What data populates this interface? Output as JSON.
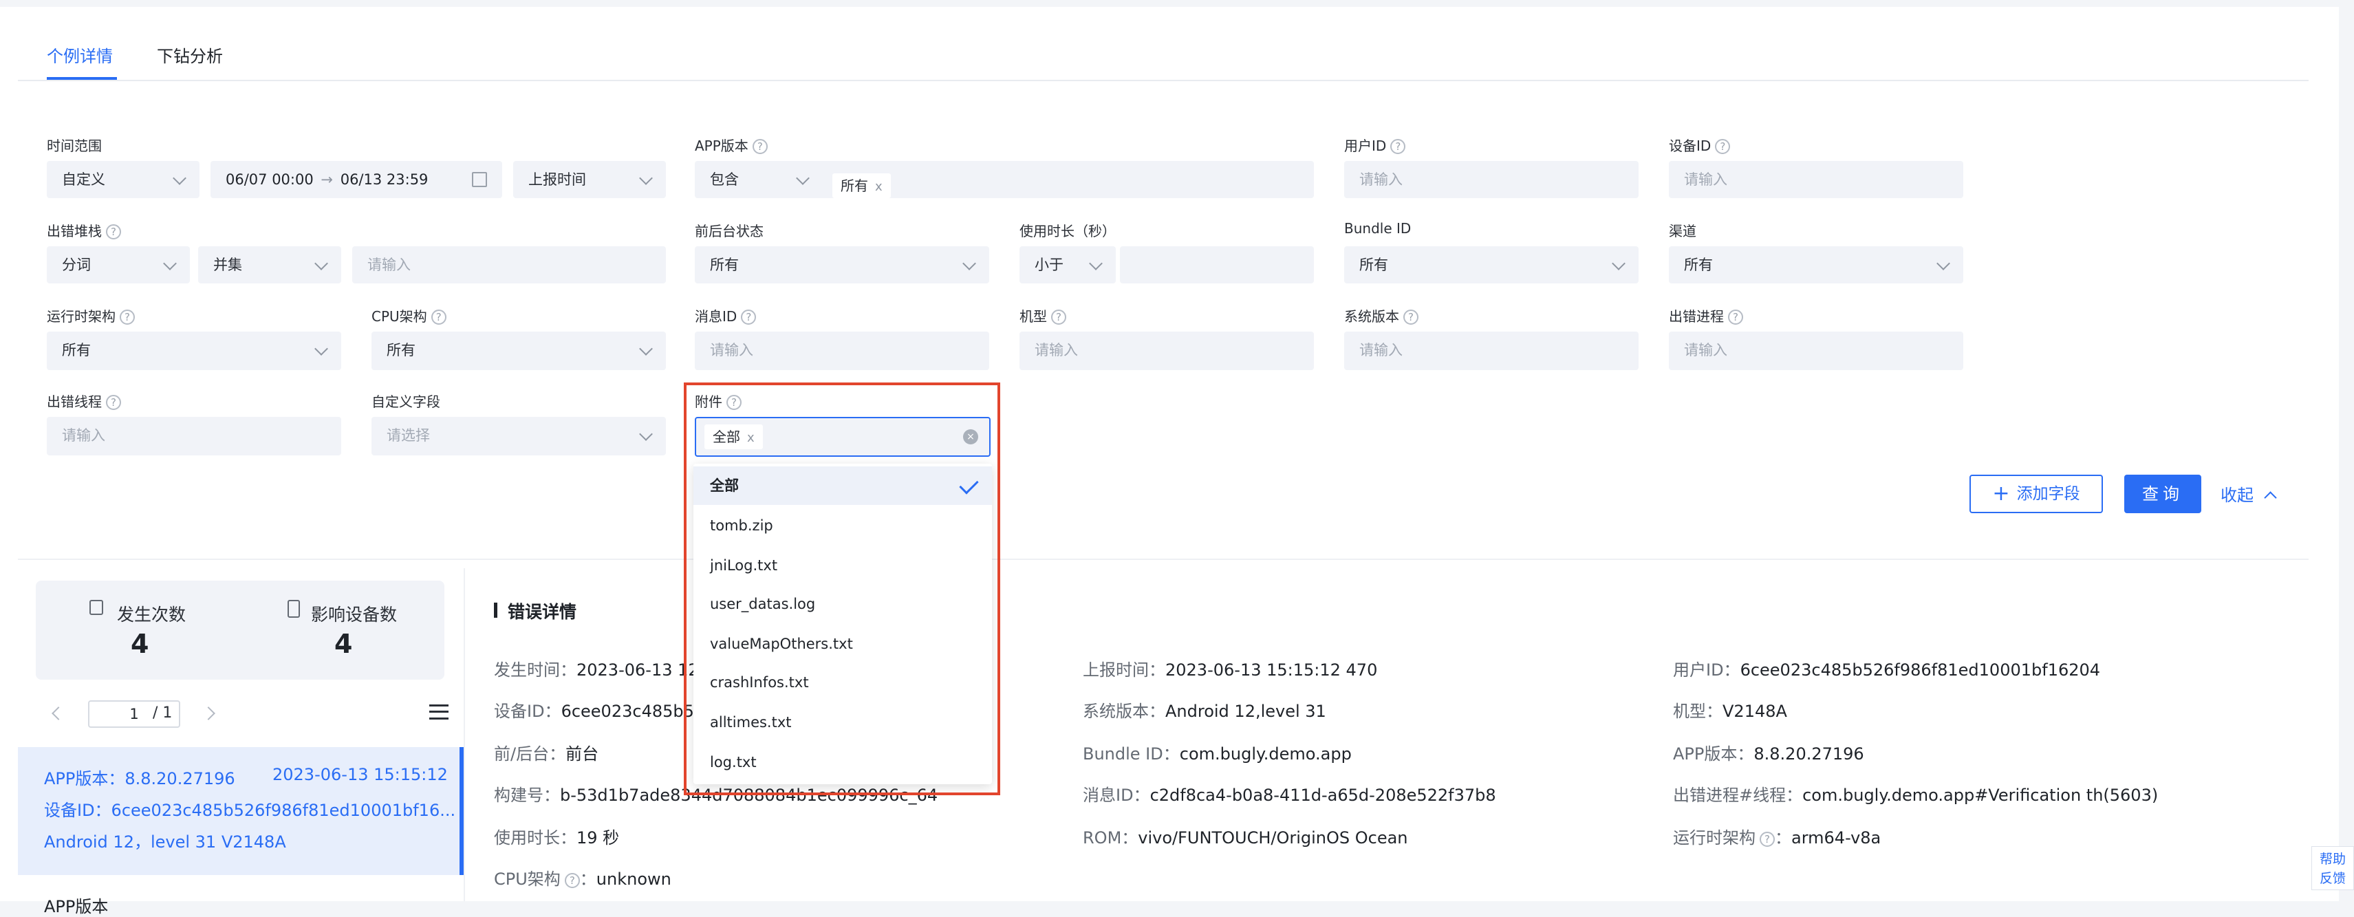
{
  "tabs": [
    {
      "label": "个例详情",
      "active": true
    },
    {
      "label": "下钻分析",
      "active": false
    }
  ],
  "filters": {
    "time_range": {
      "label": "时间范围",
      "mode": "自定义",
      "start": "06/07 00:00",
      "end": "06/13 23:59",
      "time_type": "上报时间"
    },
    "app_version": {
      "label": "APP版本",
      "op": "包含",
      "tag": "所有"
    },
    "user_id": {
      "label": "用户ID",
      "placeholder": "请输入"
    },
    "device_id": {
      "label": "设备ID",
      "placeholder": "请输入"
    },
    "stack": {
      "label": "出错堆栈",
      "mode": "分词",
      "join": "并集",
      "placeholder": "请输入"
    },
    "fg_state": {
      "label": "前后台状态",
      "value": "所有"
    },
    "usage_duration": {
      "label": "使用时长（秒）",
      "op": "小于"
    },
    "bundle_id": {
      "label": "Bundle ID",
      "value": "所有"
    },
    "channel": {
      "label": "渠道",
      "value": "所有"
    },
    "runtime_arch": {
      "label": "运行时架构",
      "value": "所有"
    },
    "cpu_arch": {
      "label": "CPU架构",
      "value": "所有"
    },
    "message_id": {
      "label": "消息ID",
      "placeholder": "请输入"
    },
    "model": {
      "label": "机型",
      "placeholder": "请输入"
    },
    "os_version": {
      "label": "系统版本",
      "placeholder": "请输入"
    },
    "crash_process": {
      "label": "出错进程",
      "placeholder": "请输入"
    },
    "crash_thread": {
      "label": "出错线程",
      "placeholder": "请输入"
    },
    "custom_field": {
      "label": "自定义字段",
      "placeholder": "请选择"
    },
    "attachment": {
      "label": "附件",
      "tag": "全部",
      "options": [
        "全部",
        "tomb.zip",
        "jniLog.txt",
        "user_datas.log",
        "valueMapOthers.txt",
        "crashInfos.txt",
        "alltimes.txt",
        "log.txt"
      ],
      "selected": "全部"
    }
  },
  "actions": {
    "add_field": "添加字段",
    "query": "查询",
    "collapse": "收起"
  },
  "stats": {
    "occurrences_label": "发生次数",
    "occurrences": "4",
    "devices_label": "影响设备数",
    "devices": "4"
  },
  "pager": {
    "page": "1",
    "total": "/ 1"
  },
  "record": {
    "line1_version": "APP版本：8.8.20.27196",
    "line1_time": "2023-06-13 15:15:12",
    "line2": "设备ID：6cee023c485b526f986f81ed10001bf16...",
    "line3": "Android 12，level 31    V2148A",
    "cut_off": "APP版本"
  },
  "detail": {
    "title": "错误详情",
    "col1": [
      {
        "k": "发生时间：",
        "v": "2023-06-13 12"
      },
      {
        "k": "设备ID：",
        "v": "6cee023c485b52"
      },
      {
        "k": "前/后台：",
        "v": "前台"
      },
      {
        "k": "构建号：",
        "v": "b-53d1b7ade8344d7088084b1ec099996c_64"
      },
      {
        "k": "使用时长：",
        "v": "19 秒"
      },
      {
        "k": "CPU架构",
        "v": "unknown"
      }
    ],
    "col2": [
      {
        "k": "上报时间：",
        "v": "2023-06-13 15:15:12 470"
      },
      {
        "k": "系统版本：",
        "v": "Android 12,level 31"
      },
      {
        "k": "Bundle ID：",
        "v": "com.bugly.demo.app"
      },
      {
        "k": "消息ID：",
        "v": "c2df8ca4-b0a8-411d-a65d-208e522f37b8"
      },
      {
        "k": "ROM：",
        "v": "vivo/FUNTOUCH/OriginOS Ocean"
      }
    ],
    "col3": [
      {
        "k": "用户ID：",
        "v": "6cee023c485b526f986f81ed10001bf16204"
      },
      {
        "k": "机型：",
        "v": "V2148A"
      },
      {
        "k": "APP版本：",
        "v": "8.8.20.27196"
      },
      {
        "k": "出错进程#线程：",
        "v": "com.bugly.demo.app#Verification th(5603)"
      },
      {
        "k": "运行时架构",
        "v": "arm64-v8a"
      }
    ]
  },
  "feedback": {
    "line1": "帮助",
    "line2": "反馈"
  },
  "colors": {
    "accent": "#2a6df4",
    "highlight": "#e2452d"
  }
}
